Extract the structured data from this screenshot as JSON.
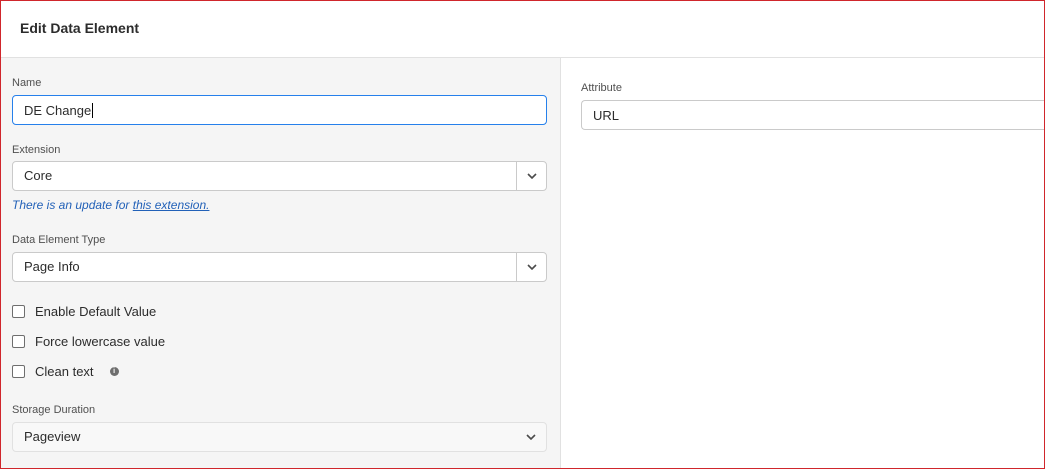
{
  "header": {
    "title": "Edit Data Element"
  },
  "form": {
    "name": {
      "label": "Name",
      "value": "DE Change"
    },
    "extension": {
      "label": "Extension",
      "value": "Core",
      "hint_text": "There is an update for",
      "hint_link": "this extension."
    },
    "type": {
      "label": "Data Element Type",
      "value": "Page Info"
    },
    "options": {
      "enable_default": "Enable Default Value",
      "force_lowercase": "Force lowercase value",
      "clean_text": "Clean text"
    },
    "storage": {
      "label": "Storage Duration",
      "value": "Pageview"
    }
  },
  "settings": {
    "attribute": {
      "label": "Attribute",
      "value": "URL"
    }
  }
}
